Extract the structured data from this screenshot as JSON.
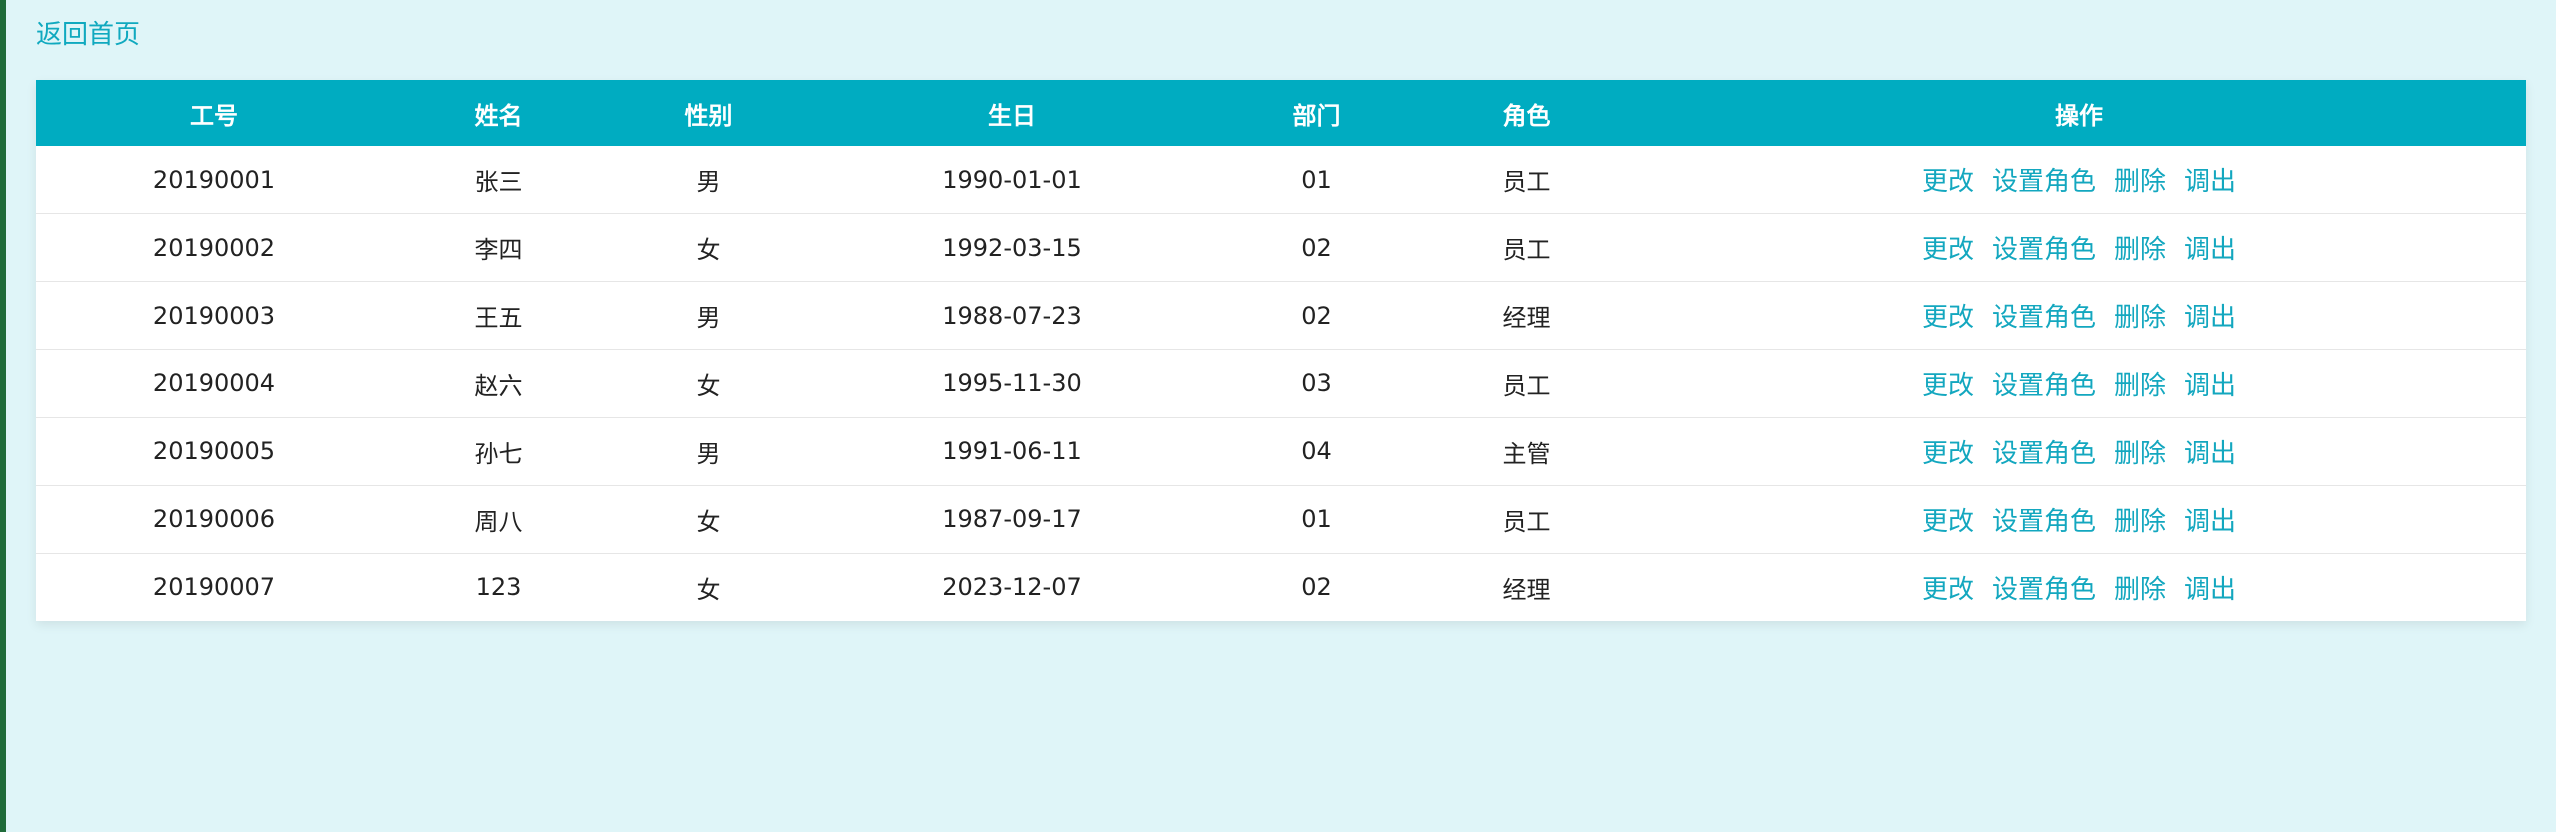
{
  "back_link": "返回首页",
  "table": {
    "headers": [
      "工号",
      "姓名",
      "性别",
      "生日",
      "部门",
      "角色",
      "操作"
    ],
    "actions": [
      "更改",
      "设置角色",
      "删除",
      "调出"
    ],
    "rows": [
      [
        "20190001",
        "张三",
        "男",
        "1990-01-01",
        "01",
        "员工"
      ],
      [
        "20190002",
        "李四",
        "女",
        "1992-03-15",
        "02",
        "员工"
      ],
      [
        "20190003",
        "王五",
        "男",
        "1988-07-23",
        "02",
        "经理"
      ],
      [
        "20190004",
        "赵六",
        "女",
        "1995-11-30",
        "03",
        "员工"
      ],
      [
        "20190005",
        "孙七",
        "男",
        "1991-06-11",
        "04",
        "主管"
      ],
      [
        "20190006",
        "周八",
        "女",
        "1987-09-17",
        "01",
        "员工"
      ],
      [
        "20190007",
        "123",
        "女",
        "2023-12-07",
        "02",
        "经理"
      ]
    ]
  },
  "colors": {
    "header_bg": "#00acc1",
    "page_bg": "#dff5f8",
    "link": "#13a7bf"
  }
}
